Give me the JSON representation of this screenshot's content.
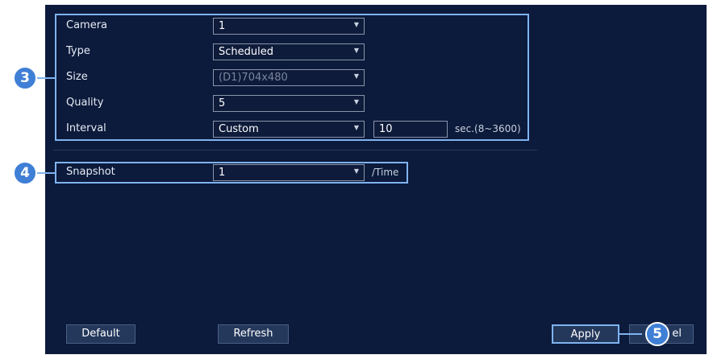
{
  "rows": {
    "camera": {
      "label": "Camera",
      "value": "1"
    },
    "type": {
      "label": "Type",
      "value": "Scheduled"
    },
    "size": {
      "label": "Size",
      "value": "(D1)704x480"
    },
    "quality": {
      "label": "Quality",
      "value": "5"
    },
    "interval": {
      "label": "Interval",
      "value": "Custom",
      "seconds": "10",
      "range_hint": "sec.(8~3600)"
    },
    "snapshot": {
      "label": "Snapshot",
      "value": "1",
      "unit": "/Time"
    }
  },
  "buttons": {
    "default": "Default",
    "refresh": "Refresh",
    "apply": "Apply",
    "cancel_partial": "el"
  },
  "callouts": {
    "three": "3",
    "four": "4",
    "five": "5"
  },
  "icons": {
    "dropdown": "chevron-down-icon"
  },
  "colors": {
    "background": "#0c1a3b",
    "highlight": "#7fb3f0",
    "callout": "#3f7fd6"
  }
}
